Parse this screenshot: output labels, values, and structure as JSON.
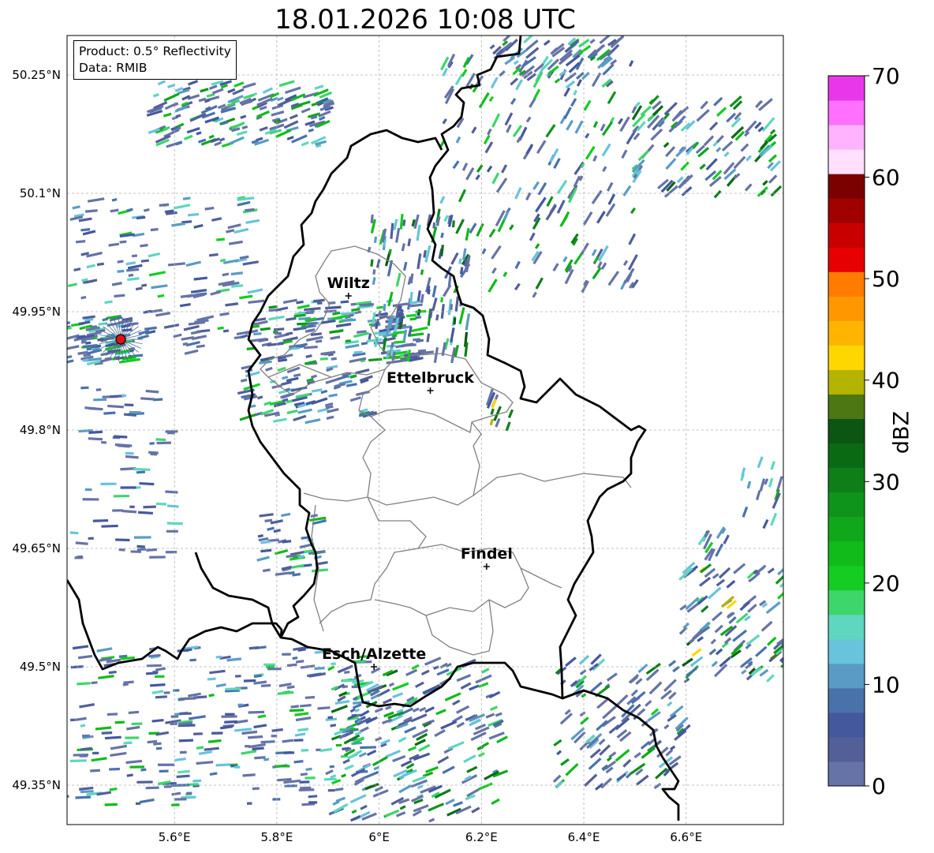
{
  "title": "18.01.2026 10:08 UTC",
  "product_box": {
    "product": "Product: 0.5° Reflectivity",
    "data": "Data: RMIB"
  },
  "colorbar": {
    "label": "dBZ",
    "ticks": [
      "0",
      "10",
      "20",
      "30",
      "40",
      "50",
      "60",
      "70"
    ],
    "range": [
      0,
      70
    ],
    "step": 2.5,
    "colors": [
      "#6673a6",
      "#525f99",
      "#44589e",
      "#4a72aa",
      "#5a9bc6",
      "#68c3dc",
      "#5fd6bf",
      "#3dd66a",
      "#14cc22",
      "#10bb1a",
      "#10a81a",
      "#0e941a",
      "#0e7f18",
      "#0a6a14",
      "#0b5612",
      "#4c7712",
      "#b3b300",
      "#ffd700",
      "#ffb400",
      "#ff9800",
      "#ff7c00",
      "#e60000",
      "#c80000",
      "#a00000",
      "#7b0000",
      "#ffe0ff",
      "#ffb3ff",
      "#ff70ff",
      "#ea36ea"
    ]
  },
  "axes": {
    "lon_range": [
      5.39,
      6.79
    ],
    "lat_range": [
      49.3,
      50.3
    ],
    "lon_ticks": [
      5.6,
      5.8,
      6.0,
      6.2,
      6.4,
      6.6
    ],
    "lon_tick_labels": [
      "5.6°E",
      "5.8°E",
      "6°E",
      "6.2°E",
      "6.4°E",
      "6.6°E"
    ],
    "lat_ticks": [
      49.35,
      49.5,
      49.65,
      49.8,
      49.95,
      50.1,
      50.25
    ],
    "lat_tick_labels": [
      "49.35°N",
      "49.5°N",
      "49.65°N",
      "49.8°N",
      "49.95°N",
      "50.1°N",
      "50.25°N"
    ],
    "grid": true
  },
  "cities": [
    {
      "name": "Wiltz",
      "lon": 5.94,
      "lat": 49.97
    },
    {
      "name": "Ettelbruck",
      "lon": 6.1,
      "lat": 49.85
    },
    {
      "name": "Findel",
      "lon": 6.21,
      "lat": 49.627
    },
    {
      "name": "Esch/Alzette",
      "lon": 5.99,
      "lat": 49.5
    }
  ],
  "radar_site": {
    "lon": 5.495,
    "lat": 49.915
  },
  "colors": {
    "border": "#000000",
    "districts": "#808080",
    "grid": "#b0b0b0",
    "radar": "#dd1111"
  }
}
